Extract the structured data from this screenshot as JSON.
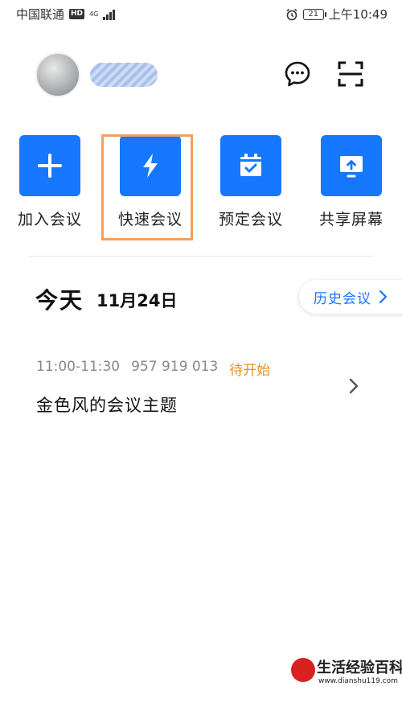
{
  "status_bar": {
    "carrier": "中国联通",
    "hd_badge": "HD",
    "network": "4G",
    "battery_level": "21",
    "time": "上午10:49"
  },
  "header": {
    "avatar_icon": "avatar-photo",
    "username_redacted": true,
    "chat_icon": "chat-bubble-icon",
    "scan_icon": "scan-icon"
  },
  "actions": [
    {
      "label": "加入会议",
      "icon": "plus-icon"
    },
    {
      "label": "快速会议",
      "icon": "lightning-icon"
    },
    {
      "label": "预定会议",
      "icon": "calendar-check-icon"
    },
    {
      "label": "共享屏幕",
      "icon": "share-screen-icon"
    }
  ],
  "today": {
    "title": "今天",
    "date": "11月24日",
    "history_label": "历史会议"
  },
  "meeting": {
    "time": "11:00-11:30",
    "meeting_id": "957 919 013",
    "status": "待开始",
    "title": "金色风的会议主题"
  },
  "watermark": {
    "title": "生活经验百科",
    "url": "www.dianshu119.com"
  },
  "colors": {
    "accent": "#1677ff",
    "status_orange": "#e8901c",
    "highlight_box": "#f0a060"
  }
}
